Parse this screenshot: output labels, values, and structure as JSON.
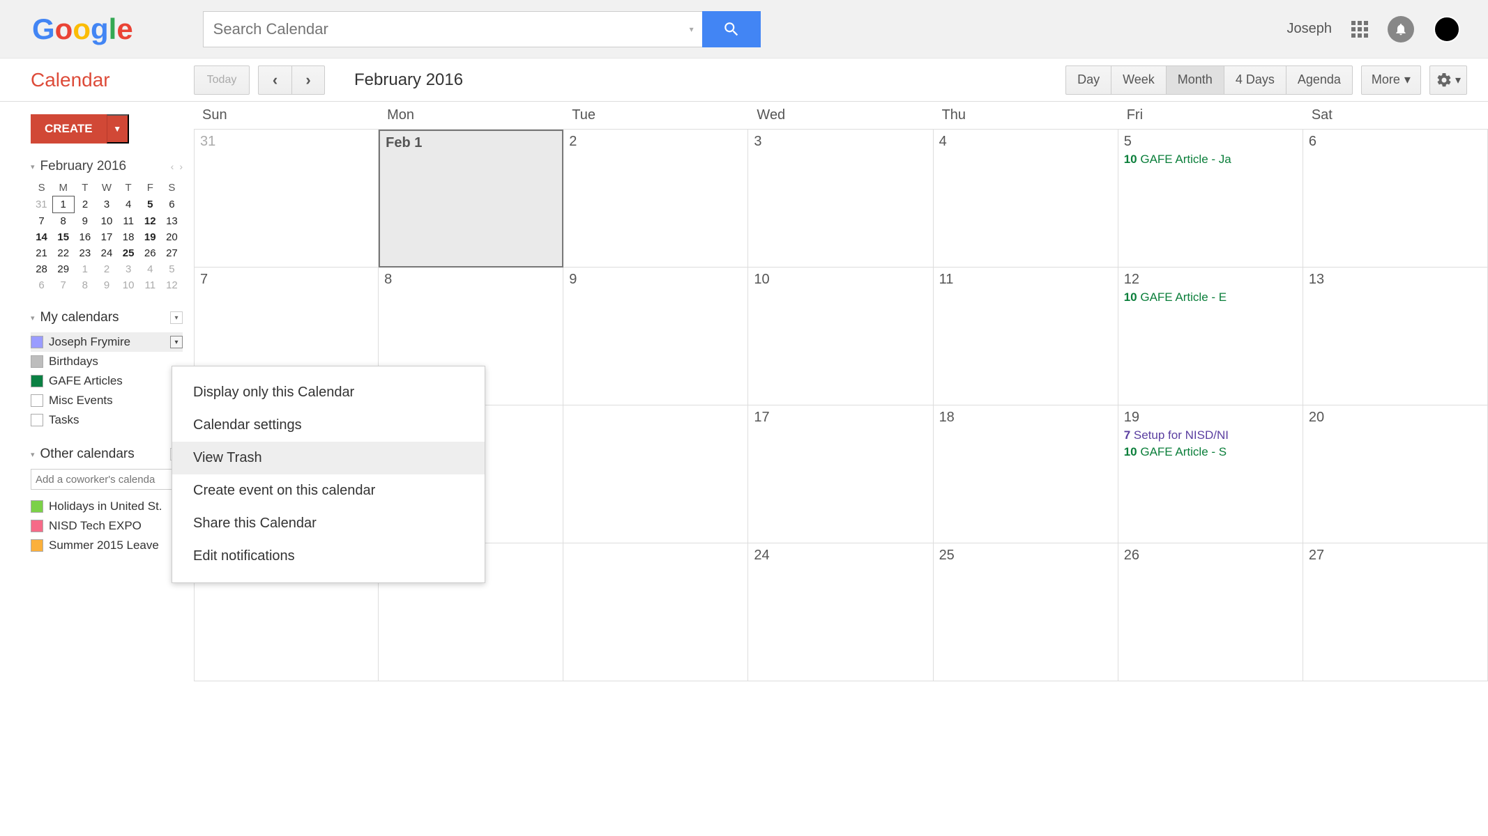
{
  "header": {
    "search_placeholder": "Search Calendar",
    "user_name": "Joseph"
  },
  "toolbar": {
    "calendar_title": "Calendar",
    "today_label": "Today",
    "month_title": "February 2016",
    "views": [
      "Day",
      "Week",
      "Month",
      "4 Days",
      "Agenda"
    ],
    "active_view": "Month",
    "more_label": "More"
  },
  "create": {
    "label": "CREATE"
  },
  "mini": {
    "title": "February 2016",
    "dow": [
      "S",
      "M",
      "T",
      "W",
      "T",
      "F",
      "S"
    ],
    "rows": [
      [
        {
          "d": "31",
          "dim": true
        },
        {
          "d": "1",
          "sel": true
        },
        {
          "d": "2"
        },
        {
          "d": "3"
        },
        {
          "d": "4"
        },
        {
          "d": "5",
          "bold": true
        },
        {
          "d": "6"
        }
      ],
      [
        {
          "d": "7"
        },
        {
          "d": "8"
        },
        {
          "d": "9"
        },
        {
          "d": "10"
        },
        {
          "d": "11"
        },
        {
          "d": "12",
          "bold": true
        },
        {
          "d": "13"
        }
      ],
      [
        {
          "d": "14",
          "bold": true
        },
        {
          "d": "15",
          "bold": true
        },
        {
          "d": "16"
        },
        {
          "d": "17"
        },
        {
          "d": "18"
        },
        {
          "d": "19",
          "bold": true
        },
        {
          "d": "20"
        }
      ],
      [
        {
          "d": "21"
        },
        {
          "d": "22"
        },
        {
          "d": "23"
        },
        {
          "d": "24"
        },
        {
          "d": "25",
          "bold": true
        },
        {
          "d": "26"
        },
        {
          "d": "27"
        }
      ],
      [
        {
          "d": "28"
        },
        {
          "d": "29"
        },
        {
          "d": "1",
          "dim": true
        },
        {
          "d": "2",
          "dim": true
        },
        {
          "d": "3",
          "dim": true
        },
        {
          "d": "4",
          "dim": true
        },
        {
          "d": "5",
          "dim": true
        }
      ],
      [
        {
          "d": "6",
          "dim": true
        },
        {
          "d": "7",
          "dim": true
        },
        {
          "d": "8",
          "dim": true
        },
        {
          "d": "9",
          "dim": true
        },
        {
          "d": "10",
          "dim": true
        },
        {
          "d": "11",
          "dim": true
        },
        {
          "d": "12",
          "dim": true
        }
      ]
    ]
  },
  "my_calendars": {
    "title": "My calendars",
    "items": [
      {
        "label": "Joseph Frymire",
        "color": "#9a9cff",
        "selected": true,
        "showDrop": true
      },
      {
        "label": "Birthdays",
        "color": "#bdbdbd"
      },
      {
        "label": "GAFE Articles",
        "color": "#0b8043"
      },
      {
        "label": "Misc Events",
        "color": "#ffffff"
      },
      {
        "label": "Tasks",
        "color": "#ffffff"
      }
    ]
  },
  "other_calendars": {
    "title": "Other calendars",
    "coworker_placeholder": "Add a coworker's calenda",
    "items": [
      {
        "label": "Holidays in United St.",
        "color": "#7bd148"
      },
      {
        "label": "NISD Tech EXPO",
        "color": "#f66a88"
      },
      {
        "label": "Summer 2015 Leave",
        "color": "#fbb03b"
      }
    ]
  },
  "context_menu": {
    "items": [
      "Display only this Calendar",
      "Calendar settings",
      "View Trash",
      "Create event on this calendar",
      "Share this Calendar",
      "Edit notifications"
    ],
    "hovered": "View Trash"
  },
  "grid": {
    "dow": [
      "Sun",
      "Mon",
      "Tue",
      "Wed",
      "Thu",
      "Fri",
      "Sat"
    ],
    "weeks": [
      {
        "days": [
          {
            "label": "31",
            "prev": true
          },
          {
            "label": "Feb 1",
            "sel": true
          },
          {
            "label": "2"
          },
          {
            "label": "3"
          },
          {
            "label": "4"
          },
          {
            "label": "5",
            "events": [
              {
                "time": "10",
                "text": "GAFE Article - Ja",
                "cls": "green"
              }
            ]
          },
          {
            "label": "6"
          }
        ]
      },
      {
        "days": [
          {
            "label": "7"
          },
          {
            "label": "8"
          },
          {
            "label": "9"
          },
          {
            "label": "10"
          },
          {
            "label": "11"
          },
          {
            "label": "12",
            "events": [
              {
                "time": "10",
                "text": "GAFE Article - E",
                "cls": "green"
              }
            ]
          },
          {
            "label": "13"
          }
        ]
      },
      {
        "days": [
          {
            "label": ""
          },
          {
            "label": ""
          },
          {
            "label": ""
          },
          {
            "label": "17"
          },
          {
            "label": "18"
          },
          {
            "label": "19",
            "events": [
              {
                "time": "7",
                "text": "Setup for NISD/NI",
                "cls": "purple"
              },
              {
                "time": "10",
                "text": "GAFE Article - S",
                "cls": "green"
              }
            ]
          },
          {
            "label": "20"
          }
        ]
      },
      {
        "days": [
          {
            "label": ""
          },
          {
            "label": ""
          },
          {
            "label": ""
          },
          {
            "label": "24"
          },
          {
            "label": "25"
          },
          {
            "label": "26"
          },
          {
            "label": "27"
          }
        ]
      }
    ]
  }
}
